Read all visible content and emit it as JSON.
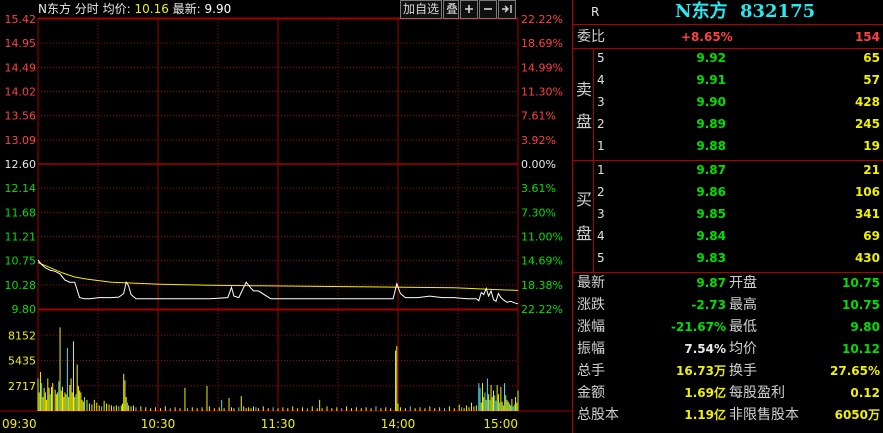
{
  "chart_header": {
    "name": "N东方",
    "mode": "分时",
    "avg_label": "均价:",
    "avg_value": "10.16",
    "latest_label": "最新:",
    "latest_value": "9.90"
  },
  "toolbar": {
    "add_watchlist": "加自选",
    "overlay": "叠"
  },
  "colors": {
    "up": "#ff4040",
    "down": "#00e000",
    "flat": "#e8e8e8",
    "grid": "#a00000",
    "price_line": "#ffffff",
    "avg_line": "#f0f000",
    "volume": "#f0f000",
    "code_title": "#28e8f0"
  },
  "chart_data": {
    "type": "line",
    "prev_close": 12.6,
    "price_ticks": [
      "15.42",
      "14.95",
      "14.49",
      "14.02",
      "13.56",
      "13.09",
      "12.60",
      "12.14",
      "11.68",
      "11.21",
      "10.75",
      "10.28",
      "9.80"
    ],
    "pct_ticks": [
      "22.22%",
      "18.69%",
      "14.99%",
      "11.30%",
      "7.61%",
      "3.92%",
      "0.00%",
      "3.61%",
      "7.30%",
      "11.00%",
      "14.69%",
      "18.38%",
      "22.22%"
    ],
    "ylim": [
      9.8,
      15.42
    ],
    "volume_ticks": [
      "8152",
      "5435",
      "2717"
    ],
    "volume_ylim": [
      0,
      10870
    ],
    "time_labels": [
      "09:30",
      "10:30",
      "11:30",
      "14:00",
      "15:00"
    ],
    "price_series": [
      [
        0,
        10.75
      ],
      [
        3,
        10.66
      ],
      [
        6,
        10.6
      ],
      [
        10,
        10.55
      ],
      [
        14,
        10.53
      ],
      [
        18,
        10.48
      ],
      [
        22,
        10.36
      ],
      [
        26,
        10.32
      ],
      [
        30,
        10.32
      ],
      [
        34,
        10.02
      ],
      [
        38,
        10.0
      ],
      [
        42,
        10.0
      ],
      [
        50,
        10.02
      ],
      [
        60,
        10.02
      ],
      [
        66,
        10.03
      ],
      [
        70,
        10.1
      ],
      [
        72,
        10.32
      ],
      [
        74,
        10.25
      ],
      [
        76,
        10.08
      ],
      [
        80,
        10.0
      ],
      [
        90,
        10.0
      ],
      [
        100,
        10.0
      ],
      [
        120,
        10.0
      ],
      [
        140,
        10.0
      ],
      [
        155,
        10.02
      ],
      [
        158,
        10.22
      ],
      [
        160,
        10.05
      ],
      [
        164,
        10.02
      ],
      [
        170,
        10.32
      ],
      [
        174,
        10.2
      ],
      [
        176,
        10.15
      ],
      [
        180,
        10.15
      ],
      [
        190,
        10.0
      ],
      [
        200,
        10.0
      ],
      [
        220,
        10.0
      ],
      [
        240,
        10.0
      ],
      [
        260,
        10.0
      ],
      [
        280,
        10.0
      ],
      [
        290,
        10.0
      ],
      [
        293,
        10.29
      ],
      [
        296,
        10.1
      ],
      [
        300,
        10.02
      ],
      [
        310,
        10.02
      ],
      [
        320,
        10.05
      ],
      [
        330,
        10.02
      ],
      [
        340,
        10.02
      ],
      [
        350,
        10.0
      ],
      [
        358,
        10.0
      ],
      [
        360,
        9.96
      ],
      [
        362,
        10.12
      ],
      [
        364,
        10.08
      ],
      [
        366,
        10.2
      ],
      [
        368,
        10.05
      ],
      [
        370,
        10.15
      ],
      [
        372,
        9.98
      ],
      [
        374,
        9.95
      ],
      [
        376,
        10.1
      ],
      [
        378,
        10.02
      ],
      [
        380,
        9.98
      ],
      [
        383,
        9.93
      ],
      [
        386,
        9.95
      ],
      [
        389,
        9.92
      ],
      [
        392,
        9.9
      ]
    ],
    "avg_series": [
      [
        0,
        10.7
      ],
      [
        10,
        10.6
      ],
      [
        20,
        10.5
      ],
      [
        30,
        10.42
      ],
      [
        40,
        10.38
      ],
      [
        60,
        10.32
      ],
      [
        80,
        10.3
      ],
      [
        100,
        10.28
      ],
      [
        140,
        10.26
      ],
      [
        180,
        10.25
      ],
      [
        220,
        10.24
      ],
      [
        260,
        10.23
      ],
      [
        300,
        10.22
      ],
      [
        340,
        10.21
      ],
      [
        370,
        10.18
      ],
      [
        392,
        10.16
      ]
    ],
    "volume_series": [
      [
        0,
        3500
      ],
      [
        1,
        2000
      ],
      [
        2,
        4200
      ],
      [
        3,
        3000
      ],
      [
        4,
        1500
      ],
      [
        5,
        2500
      ],
      [
        6,
        2000
      ],
      [
        7,
        1200
      ],
      [
        8,
        3500
      ],
      [
        9,
        2500
      ],
      [
        10,
        1800
      ],
      [
        11,
        2600
      ],
      [
        12,
        3000
      ],
      [
        14,
        2300
      ],
      [
        15,
        1800
      ],
      [
        16,
        2000
      ],
      [
        17,
        3200
      ],
      [
        18,
        9000
      ],
      [
        19,
        2200
      ],
      [
        20,
        2600
      ],
      [
        21,
        1500
      ],
      [
        22,
        2000
      ],
      [
        23,
        1800
      ],
      [
        24,
        6800
      ],
      [
        25,
        1500
      ],
      [
        26,
        2800
      ],
      [
        27,
        3500
      ],
      [
        28,
        2000
      ],
      [
        29,
        7500
      ],
      [
        30,
        1500
      ],
      [
        31,
        1800
      ],
      [
        32,
        5000
      ],
      [
        33,
        2700
      ],
      [
        34,
        2200
      ],
      [
        35,
        2000
      ],
      [
        36,
        1200
      ],
      [
        37,
        1000
      ],
      [
        38,
        1500
      ],
      [
        40,
        1200
      ],
      [
        42,
        800
      ],
      [
        44,
        700
      ],
      [
        46,
        1200
      ],
      [
        48,
        900
      ],
      [
        50,
        600
      ],
      [
        52,
        500
      ],
      [
        54,
        1100
      ],
      [
        56,
        800
      ],
      [
        58,
        700
      ],
      [
        60,
        600
      ],
      [
        62,
        500
      ],
      [
        64,
        600
      ],
      [
        66,
        500
      ],
      [
        68,
        600
      ],
      [
        69,
        800
      ],
      [
        70,
        4000
      ],
      [
        71,
        3300
      ],
      [
        72,
        1500
      ],
      [
        73,
        900
      ],
      [
        74,
        600
      ],
      [
        76,
        500
      ],
      [
        78,
        600
      ],
      [
        80,
        400
      ],
      [
        84,
        500
      ],
      [
        88,
        400
      ],
      [
        92,
        300
      ],
      [
        96,
        400
      ],
      [
        100,
        300
      ],
      [
        104,
        500
      ],
      [
        108,
        300
      ],
      [
        112,
        400
      ],
      [
        116,
        300
      ],
      [
        120,
        2500
      ],
      [
        122,
        300
      ],
      [
        126,
        400
      ],
      [
        130,
        300
      ],
      [
        134,
        400
      ],
      [
        138,
        2700
      ],
      [
        140,
        500
      ],
      [
        144,
        300
      ],
      [
        148,
        400
      ],
      [
        150,
        1200
      ],
      [
        152,
        300
      ],
      [
        156,
        1400
      ],
      [
        158,
        400
      ],
      [
        160,
        300
      ],
      [
        164,
        400
      ],
      [
        166,
        1600
      ],
      [
        168,
        500
      ],
      [
        170,
        300
      ],
      [
        172,
        400
      ],
      [
        174,
        300
      ],
      [
        176,
        500
      ],
      [
        178,
        400
      ],
      [
        180,
        300
      ],
      [
        184,
        500
      ],
      [
        188,
        300
      ],
      [
        192,
        400
      ],
      [
        196,
        300
      ],
      [
        200,
        400
      ],
      [
        204,
        300
      ],
      [
        208,
        500
      ],
      [
        212,
        300
      ],
      [
        216,
        400
      ],
      [
        220,
        300
      ],
      [
        224,
        500
      ],
      [
        228,
        300
      ],
      [
        230,
        1200
      ],
      [
        232,
        300
      ],
      [
        236,
        500
      ],
      [
        240,
        300
      ],
      [
        244,
        400
      ],
      [
        248,
        300
      ],
      [
        252,
        500
      ],
      [
        256,
        300
      ],
      [
        260,
        400
      ],
      [
        264,
        300
      ],
      [
        268,
        400
      ],
      [
        272,
        300
      ],
      [
        276,
        500
      ],
      [
        280,
        300
      ],
      [
        284,
        400
      ],
      [
        288,
        300
      ],
      [
        292,
        6500
      ],
      [
        293,
        7000
      ],
      [
        294,
        800
      ],
      [
        296,
        400
      ],
      [
        300,
        300
      ],
      [
        304,
        500
      ],
      [
        308,
        300
      ],
      [
        312,
        400
      ],
      [
        316,
        300
      ],
      [
        320,
        500
      ],
      [
        324,
        300
      ],
      [
        328,
        400
      ],
      [
        332,
        300
      ],
      [
        336,
        500
      ],
      [
        340,
        300
      ],
      [
        344,
        700
      ],
      [
        346,
        400
      ],
      [
        348,
        300
      ],
      [
        350,
        600
      ],
      [
        352,
        400
      ],
      [
        354,
        900
      ],
      [
        356,
        500
      ],
      [
        358,
        600
      ],
      [
        360,
        3000
      ],
      [
        361,
        2500
      ],
      [
        362,
        900
      ],
      [
        363,
        3000
      ],
      [
        364,
        1500
      ],
      [
        365,
        2000
      ],
      [
        366,
        1200
      ],
      [
        367,
        3500
      ],
      [
        368,
        1800
      ],
      [
        369,
        1200
      ],
      [
        370,
        2800
      ],
      [
        371,
        1500
      ],
      [
        372,
        2200
      ],
      [
        373,
        1700
      ],
      [
        374,
        1100
      ],
      [
        375,
        2800
      ],
      [
        376,
        1800
      ],
      [
        377,
        900
      ],
      [
        378,
        2600
      ],
      [
        379,
        1000
      ],
      [
        380,
        600
      ],
      [
        381,
        3000
      ],
      [
        382,
        1700
      ],
      [
        383,
        1200
      ],
      [
        384,
        1000
      ],
      [
        385,
        800
      ],
      [
        386,
        600
      ],
      [
        387,
        1300
      ],
      [
        388,
        500
      ],
      [
        389,
        700
      ],
      [
        390,
        1500
      ],
      [
        391,
        900
      ],
      [
        392,
        2200
      ]
    ]
  },
  "quote": {
    "market_flag": "R",
    "title": "N东方  832175",
    "weibi_label": "委比",
    "weibi_pct": "+8.65%",
    "weibi_diff": "154",
    "sell_label_1": "卖",
    "sell_label_2": "盘",
    "buy_label_1": "买",
    "buy_label_2": "盘",
    "sell": [
      {
        "level": "5",
        "price": "9.92",
        "volume": "65"
      },
      {
        "level": "4",
        "price": "9.91",
        "volume": "57"
      },
      {
        "level": "3",
        "price": "9.90",
        "volume": "428"
      },
      {
        "level": "2",
        "price": "9.89",
        "volume": "245"
      },
      {
        "level": "1",
        "price": "9.88",
        "volume": "19"
      }
    ],
    "buy": [
      {
        "level": "1",
        "price": "9.87",
        "volume": "21"
      },
      {
        "level": "2",
        "price": "9.86",
        "volume": "106"
      },
      {
        "level": "3",
        "price": "9.85",
        "volume": "341"
      },
      {
        "level": "4",
        "price": "9.84",
        "volume": "69"
      },
      {
        "level": "5",
        "price": "9.83",
        "volume": "430"
      }
    ],
    "stats": [
      {
        "label_a": "最新",
        "value_a": "9.87",
        "color_a": "g",
        "label_b": "开盘",
        "value_b": "10.75",
        "color_b": "g"
      },
      {
        "label_a": "涨跌",
        "value_a": "-2.73",
        "color_a": "g",
        "label_b": "最高",
        "value_b": "10.75",
        "color_b": "g"
      },
      {
        "label_a": "涨幅",
        "value_a": "-21.67%",
        "color_a": "g",
        "label_b": "最低",
        "value_b": "9.80",
        "color_b": "g"
      },
      {
        "label_a": "振幅",
        "value_a": "7.54%",
        "color_a": "w",
        "label_b": "均价",
        "value_b": "10.12",
        "color_b": "g"
      },
      {
        "label_a": "总手",
        "value_a": "16.73万",
        "color_a": "y",
        "label_b": "换手",
        "value_b": "27.65%",
        "color_b": "y"
      },
      {
        "label_a": "金额",
        "value_a": "1.69亿",
        "color_a": "y",
        "label_b": "每股盈利",
        "value_b": "0.12",
        "color_b": "y"
      },
      {
        "label_a": "总股本",
        "value_a": "1.19亿",
        "color_a": "y",
        "label_b": "非限售股本",
        "value_b": "6050万",
        "color_b": "y"
      }
    ]
  }
}
